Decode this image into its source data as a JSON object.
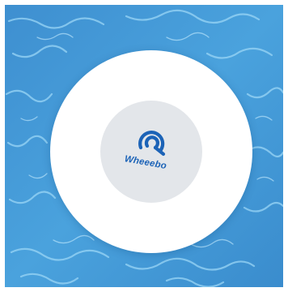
{
  "product": {
    "brand_name": "Wheeebo",
    "logo_icon": "wheeebo-swirl-logo-icon"
  },
  "colors": {
    "water_base": "#3f96d6",
    "water_light": "#8fd0f4",
    "disc": "#ffffff",
    "inner_circle": "#e3e6ea",
    "brand": "#1c63b7"
  }
}
